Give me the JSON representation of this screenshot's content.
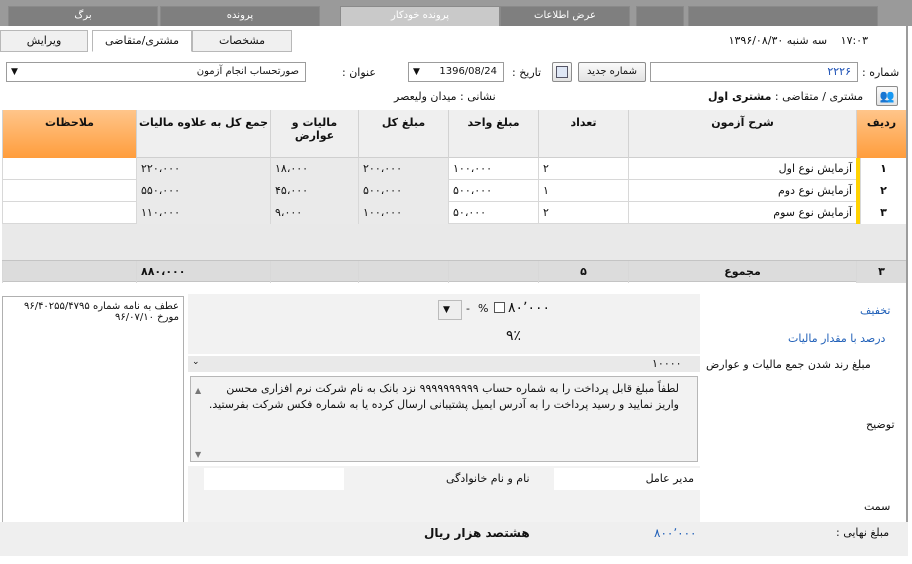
{
  "top_tabs": [
    "برگ",
    "پرونده",
    "پرونده خودکار",
    "عرض اطلاعات"
  ],
  "subtabs": {
    "edit": "ویرایش",
    "customer": "مشتری/متقاضی",
    "specs": "مشخصات"
  },
  "header": {
    "time": "۱۷:۰۳",
    "day": "سه شنبه ۱۳۹۶/۰۸/۳۰"
  },
  "form": {
    "number_label": "شماره :",
    "number_value": "۲۲۲۶",
    "new_number_button": "شماره جدید",
    "date_label": "تاریخ :",
    "date_value": "1396/08/24",
    "title_label": "عنوان :",
    "title_value": "صورتحساب انجام آزمون"
  },
  "customer": {
    "label": "مشتری / متقاضی :",
    "name": "مشتری اول",
    "address_label": "نشانی :",
    "address_value": "میدان ولیعصر"
  },
  "table": {
    "columns": {
      "row": "ردیف",
      "desc": "شرح آزمون",
      "qty": "تعداد",
      "unit_price": "مبلغ واحد",
      "total": "مبلغ کل",
      "tax": "مالیات و عوارض",
      "grand": "جمع کل به علاوه مالیات",
      "notes": "ملاحظات"
    },
    "rows": [
      {
        "idx": "۱",
        "desc": "آزمایش نوع اول",
        "qty": "۲",
        "unit": "۱۰۰،۰۰۰",
        "total": "۲۰۰،۰۰۰",
        "tax": "۱۸،۰۰۰",
        "grand": "۲۲۰،۰۰۰",
        "notes": ""
      },
      {
        "idx": "۲",
        "desc": "آزمایش نوع دوم",
        "qty": "۱",
        "unit": "۵۰۰،۰۰۰",
        "total": "۵۰۰،۰۰۰",
        "tax": "۴۵،۰۰۰",
        "grand": "۵۵۰،۰۰۰",
        "notes": ""
      },
      {
        "idx": "۳",
        "desc": "آزمایش نوع سوم",
        "qty": "۲",
        "unit": "۵۰،۰۰۰",
        "total": "۱۰۰،۰۰۰",
        "tax": "۹،۰۰۰",
        "grand": "۱۱۰،۰۰۰",
        "notes": ""
      }
    ],
    "totals": {
      "count": "۳",
      "label": "مجموع",
      "qty": "۵",
      "grand": "۸۸۰،۰۰۰"
    }
  },
  "reference_note": "عطف به نامه شماره ۹۶/۴۰۲۵۵/۴۷۹۵ مورخ ۹۶/۰۷/۱۰",
  "bottom": {
    "discount_label": "تخفیف",
    "discount_value": "۸۰٬۰۰۰",
    "percent_sign": "%",
    "tax_percent_label": "درصد با مقدار مالیات",
    "tax_percent_value": "۹٪",
    "rounding_label": "مبلغ رند شدن جمع مالیات و عوارض",
    "rounding_value": "۱۰۰۰۰",
    "description_label": "توضیح",
    "description_text": "لطفاً مبلغ قابل پرداخت را به شماره حساب ۹۹۹۹۹۹۹۹۹۹ نزد بانک به نام شرکت نرم افزاری محسن واریز نمایید و رسید پرداخت را به آدرس ایمیل پشتیبانی ارسال کرده یا به شماره فکس شرکت بفرستید.",
    "position_label": "سمت",
    "position_value": "مدیر عامل",
    "name_label": "نام و نام خانوادگی",
    "final_label": "مبلغ نهایی :",
    "final_value": "۸۰۰٬۰۰۰",
    "final_words": "هشتصد هزار ریال"
  }
}
